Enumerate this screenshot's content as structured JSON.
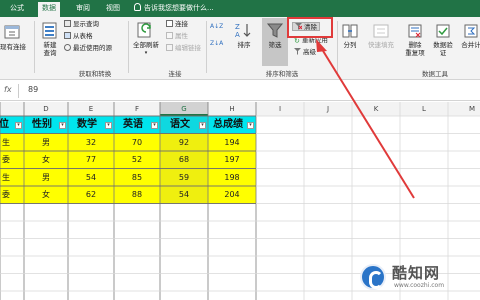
{
  "tabs": [
    {
      "label": "公式",
      "active": false
    },
    {
      "label": "数据",
      "active": true
    },
    {
      "label": "审阅",
      "active": false
    },
    {
      "label": "视图",
      "active": false
    }
  ],
  "tell_me": "告诉我您想要做什么...",
  "ribbon": {
    "get_transform": {
      "existing_connections": "现有连接",
      "new_query": "新建\n查询",
      "show_queries": "显示查询",
      "from_table": "从表格",
      "recent_sources": "最近使用的源",
      "group_label": "获取和转换"
    },
    "connections": {
      "refresh_all": "全部刷新",
      "connections": "连接",
      "properties": "属性",
      "edit_links": "编辑链接",
      "group_label": "连接"
    },
    "sort_filter": {
      "sort": "排序",
      "filter": "筛选",
      "clear": "清除",
      "reapply": "重新应用",
      "advanced": "高级",
      "group_label": "排序和筛选"
    },
    "data_tools": {
      "text_to_columns": "分列",
      "flash_fill": "快速填充",
      "remove_duplicates": "删除\n重复项",
      "data_validation": "数据验\n证",
      "consolidate": "合并计",
      "group_label": "数据工具"
    }
  },
  "formula_bar": {
    "fx": "fx",
    "value": "89"
  },
  "columns": [
    "D",
    "E",
    "F",
    "G",
    "H",
    "I",
    "J",
    "K",
    "L",
    "M"
  ],
  "selected_column": "G",
  "table": {
    "headers": [
      "位",
      "性别",
      "数学",
      "英语",
      "语文",
      "总成绩"
    ],
    "rows": [
      [
        "生",
        "男",
        "32",
        "70",
        "92",
        "194"
      ],
      [
        "委",
        "女",
        "77",
        "52",
        "68",
        "197"
      ],
      [
        "生",
        "男",
        "54",
        "85",
        "59",
        "198"
      ],
      [
        "委",
        "女",
        "62",
        "88",
        "54",
        "204"
      ]
    ],
    "filter_glyph": "▾"
  },
  "colors": {
    "excel_green": "#217346",
    "row_fill": "#ffff00",
    "header_fill": "#00e5ee",
    "annotation_red": "#e03a3a"
  },
  "watermark": {
    "brand": "酷知网",
    "url": "www.coozhi.com"
  }
}
